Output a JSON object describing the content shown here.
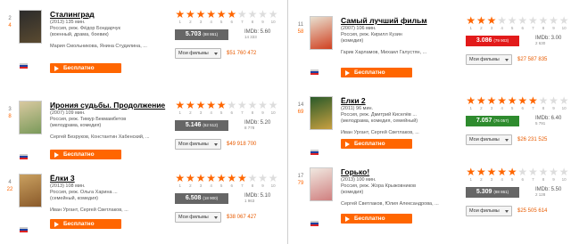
{
  "ui": {
    "watch_label": "Бесплатно",
    "my_films_label": "Мои фильмы",
    "star_numbers": [
      "1",
      "2",
      "3",
      "4",
      "5",
      "6",
      "7",
      "8",
      "9",
      "10"
    ]
  },
  "films": [
    {
      "rank": "2",
      "change": "4",
      "title": "Сталинград",
      "meta1": "(2013) 135 мин.",
      "meta2": "Россия, реж. Фёдор Бондарчук",
      "meta3": "(военный, драма, боевик)",
      "cast": "Мария Смольникова, Янина Студилина, ...",
      "score": "5.703",
      "votes": "(88 861)",
      "score_color": "#666666",
      "stars": 6,
      "imdb": "IMDb: 5.60",
      "imdb_votes": "14 333",
      "money": "$51 760 472",
      "poster_colors": [
        "#2b2b2b",
        "#5a4a30"
      ],
      "flag": "ru"
    },
    {
      "rank": "3",
      "change": "8",
      "title": "Ирония судьбы. Продолжение",
      "meta1": "(2007) 109 мин.",
      "meta2": "Россия, реж. Тимур Бекмамбетов",
      "meta3": "(мелодрама, комедия)",
      "cast": "Сергей Безруков, Константин Хабенский, ...",
      "score": "5.146",
      "votes": "(62 512)",
      "score_color": "#666666",
      "stars": 5,
      "imdb": "IMDb: 5.20",
      "imdb_votes": "8 778",
      "money": "$49 918 700",
      "poster_colors": [
        "#d9c9a0",
        "#7a9a5a"
      ],
      "flag": "ru"
    },
    {
      "rank": "4",
      "change": "22",
      "title": "Ёлки 3",
      "meta1": "(2013) 108 мин.",
      "meta2": "Россия, реж. Ольга Харина ...",
      "meta3": "(семейный, комедия)",
      "cast": "Иван Ургант, Сергей Светлаков, ...",
      "score": "6.508",
      "votes": "(18 900)",
      "score_color": "#666666",
      "stars": 7,
      "imdb": "IMDb: 5.10",
      "imdb_votes": "1 963",
      "money": "$38 067 427",
      "poster_colors": [
        "#c9a060",
        "#8a5a2a"
      ],
      "flag": "ru"
    },
    {
      "rank": "11",
      "change": "58",
      "title": "Самый лучший фильм",
      "meta1": "(2007) 106 мин.",
      "meta2": "Россия, реж. Кирилл Кузин",
      "meta3": "(комедия)",
      "cast": "Гарик Харламов, Михаил Галустян, ...",
      "score": "3.086",
      "votes": "(79 903)",
      "score_color": "#e21a1a",
      "stars": 3,
      "imdb": "IMDb: 3.00",
      "imdb_votes": "2 630",
      "money": "$27 587 835",
      "poster_colors": [
        "#e8e0d0",
        "#d04020"
      ],
      "flag": "ru"
    },
    {
      "rank": "14",
      "change": "69",
      "title": "Ёлки 2",
      "meta1": "(2011) 96 мин.",
      "meta2": "Россия, реж. Дмитрий Киселёв ...",
      "meta3": "(мелодрама, комедия, семейный)",
      "cast": "Иван Ургант, Сергей Светлаков, ...",
      "score": "7.057",
      "votes": "(76 057)",
      "score_color": "#2e8b2e",
      "stars": 7,
      "imdb": "IMDb: 6.40",
      "imdb_votes": "5 791",
      "money": "$26 231 525",
      "poster_colors": [
        "#2a5a2a",
        "#c8a040"
      ],
      "flag": "ru"
    },
    {
      "rank": "17",
      "change": "79",
      "title": "Горько!",
      "meta1": "(2013) 100 мин.",
      "meta2": "Россия, реж. Жора Крыжовников",
      "meta3": "(комедия)",
      "cast": "Сергей Светлаков, Юлия Александрова, ...",
      "score": "5.309",
      "votes": "(88 861)",
      "score_color": "#666666",
      "stars": 5,
      "imdb": "IMDb: 5.50",
      "imdb_votes": "2 128",
      "money": "$25 505 614",
      "poster_colors": [
        "#f0e8e0",
        "#d08080"
      ],
      "flag": "ru"
    }
  ]
}
